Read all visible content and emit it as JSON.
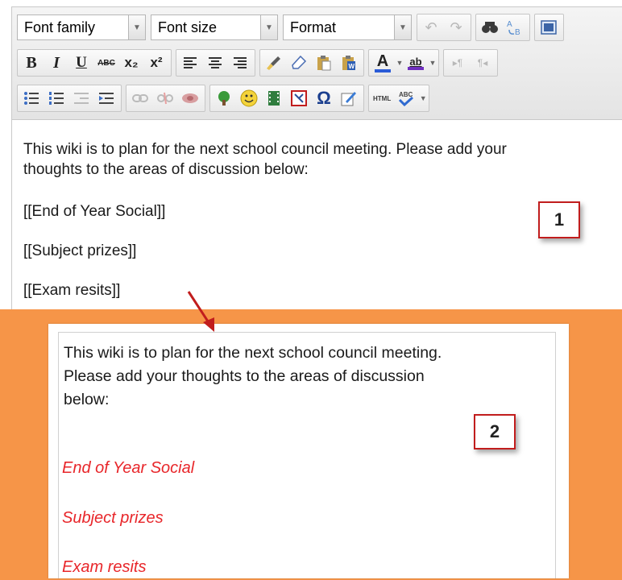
{
  "toolbar": {
    "font_family": "Font family",
    "font_size": "Font size",
    "format": "Format",
    "row1_icons": [
      "undo-icon",
      "redo-icon",
      "find-icon",
      "replace-icon",
      "fullscreen-icon"
    ],
    "row2": {
      "bold": "B",
      "italic": "I",
      "underline": "U",
      "strikethrough": "ABC",
      "subscript": "x₂",
      "superscript": "x²",
      "text_color": "A",
      "highlight": "ab"
    },
    "row3_icons": [
      "bullet-list-icon",
      "numbered-list-icon",
      "outdent-icon",
      "indent-icon",
      "link-icon",
      "unlink-icon",
      "anchor-icon",
      "image-icon",
      "emoticon-icon",
      "media-icon",
      "spellcheck-icon",
      "special-char-icon",
      "edit-icon",
      "html-icon"
    ],
    "html_label": "HTML",
    "omega": "Ω"
  },
  "editor": {
    "intro_line1": "This wiki is to plan for the next school council meeting. Please add your",
    "intro_line2": "thoughts to the areas of discussion below:",
    "links": [
      "[[End of Year Social]]",
      "[[Subject prizes]]",
      "[[Exam resits]]"
    ]
  },
  "preview": {
    "intro_line1": "This wiki is to plan for the next school council meeting.",
    "intro_line2": "Please add your thoughts to the areas of discussion",
    "intro_line3": "below:",
    "links": [
      "End of Year Social",
      "Subject prizes",
      "Exam resits"
    ]
  },
  "callouts": {
    "first": "1",
    "second": "2"
  },
  "colors": {
    "band": "#f69548",
    "link": "#e8262a",
    "callout_border": "#c11d1d",
    "arrow": "#c11d1d"
  }
}
